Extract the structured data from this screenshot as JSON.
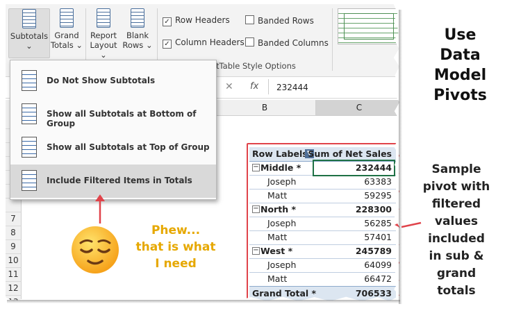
{
  "ribbon": {
    "subtotals": {
      "line1": "Subtotals",
      "line2": "⌄"
    },
    "grand_totals": {
      "line1": "Grand",
      "line2": "Totals ⌄"
    },
    "report_layout": {
      "line1": "Report",
      "line2": "Layout ⌄"
    },
    "blank_rows": {
      "line1": "Blank",
      "line2": "Rows ⌄"
    },
    "row_headers": {
      "label": "Row Headers",
      "checked": true
    },
    "column_headers": {
      "label": "Column Headers",
      "checked": true
    },
    "banded_rows": {
      "label": "Banded Rows",
      "checked": false
    },
    "banded_columns": {
      "label": "Banded Columns",
      "checked": false
    },
    "group_label": "otTable Style Options"
  },
  "formula_bar": {
    "cancel": "✕",
    "enter": "✓",
    "fx": "fx",
    "value": "232444"
  },
  "columns": {
    "b": "B",
    "c": "C"
  },
  "row_numbers": [
    "7",
    "8",
    "9",
    "10",
    "11",
    "12",
    "13"
  ],
  "menu": {
    "items": [
      {
        "label": "Do Not Show Subtotals"
      },
      {
        "label": "Show all Subtotals at Bottom of Group"
      },
      {
        "label": "Show all Subtotals at Top of Group"
      },
      {
        "label": "Include Filtered Items in Totals"
      }
    ]
  },
  "pivot": {
    "header_rows": "Row Labels",
    "header_values": "Sum of Net Sales",
    "rows": [
      {
        "label": "Middle *",
        "value": "232444",
        "level": "group"
      },
      {
        "label": "Joseph",
        "value": "63383",
        "level": "item"
      },
      {
        "label": "Matt",
        "value": "59295",
        "level": "item"
      },
      {
        "label": "North *",
        "value": "228300",
        "level": "group"
      },
      {
        "label": "Joseph",
        "value": "56285",
        "level": "item"
      },
      {
        "label": "Matt",
        "value": "57401",
        "level": "item"
      },
      {
        "label": "West *",
        "value": "245789",
        "level": "group"
      },
      {
        "label": "Joseph",
        "value": "64099",
        "level": "item"
      },
      {
        "label": "Matt",
        "value": "66472",
        "level": "item"
      }
    ],
    "grand_total_label": "Grand Total *",
    "grand_total_value": "706533",
    "collapse_symbol": "−"
  },
  "annotations": {
    "title": [
      "Use",
      "Data",
      "Model",
      "Pivots"
    ],
    "phew": [
      "Phew...",
      "that is what",
      "I need"
    ],
    "sample": [
      "Sample",
      "pivot with",
      "filtered",
      "values",
      "included",
      "in sub &",
      "grand",
      "totals"
    ]
  },
  "colors": {
    "accent_red": "#e0434a",
    "annotation_yellow": "#e6a800",
    "pivot_header": "#dce6f1"
  }
}
